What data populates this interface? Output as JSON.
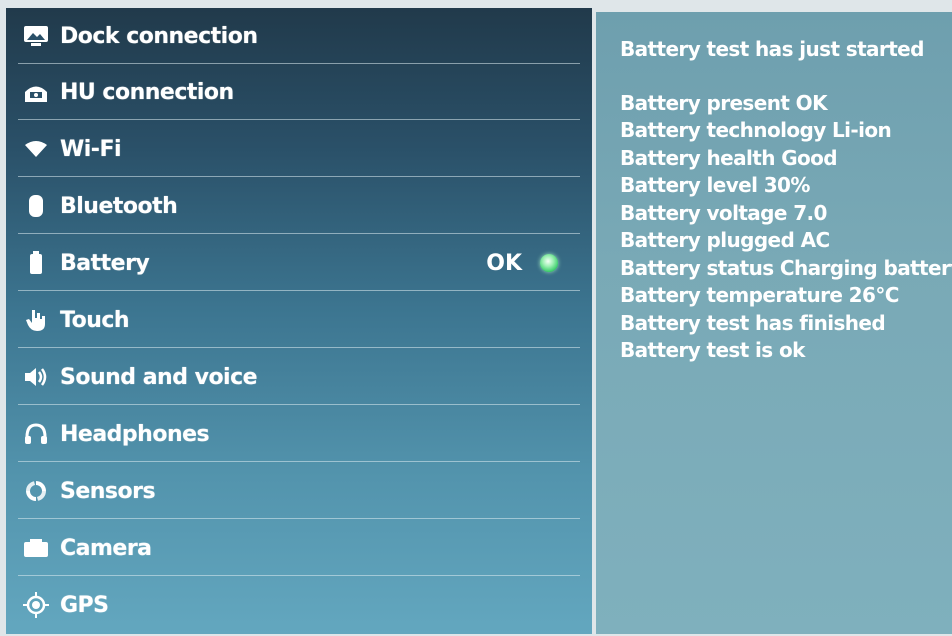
{
  "menu": {
    "items": [
      {
        "label": "Dock connection",
        "icon": "dock-icon"
      },
      {
        "label": "HU connection",
        "icon": "car-icon"
      },
      {
        "label": "Wi-Fi",
        "icon": "wifi-icon"
      },
      {
        "label": "Bluetooth",
        "icon": "bluetooth-icon"
      },
      {
        "label": "Battery",
        "icon": "battery-icon",
        "status": "OK",
        "status_color": "#3fcf6e"
      },
      {
        "label": "Touch",
        "icon": "touch-icon"
      },
      {
        "label": "Sound and voice",
        "icon": "speaker-icon"
      },
      {
        "label": "Headphones",
        "icon": "headphones-icon"
      },
      {
        "label": "Sensors",
        "icon": "sensors-icon"
      },
      {
        "label": "Camera",
        "icon": "camera-icon"
      },
      {
        "label": "GPS",
        "icon": "gps-icon"
      }
    ]
  },
  "log": {
    "header": "Battery test has just started",
    "lines": [
      "Battery present OK",
      "Battery technology Li-ion",
      "Battery health Good",
      "Battery level 30%",
      "Battery voltage 7.0",
      "Battery plugged AC",
      "Battery status Charging battery",
      "Battery temperature 26°C",
      "Battery test has finished",
      "Battery test is ok"
    ]
  },
  "colors": {
    "menu_text": "#ffffff",
    "log_text": "#ffffff",
    "status_ok": "#3fcf6e"
  }
}
